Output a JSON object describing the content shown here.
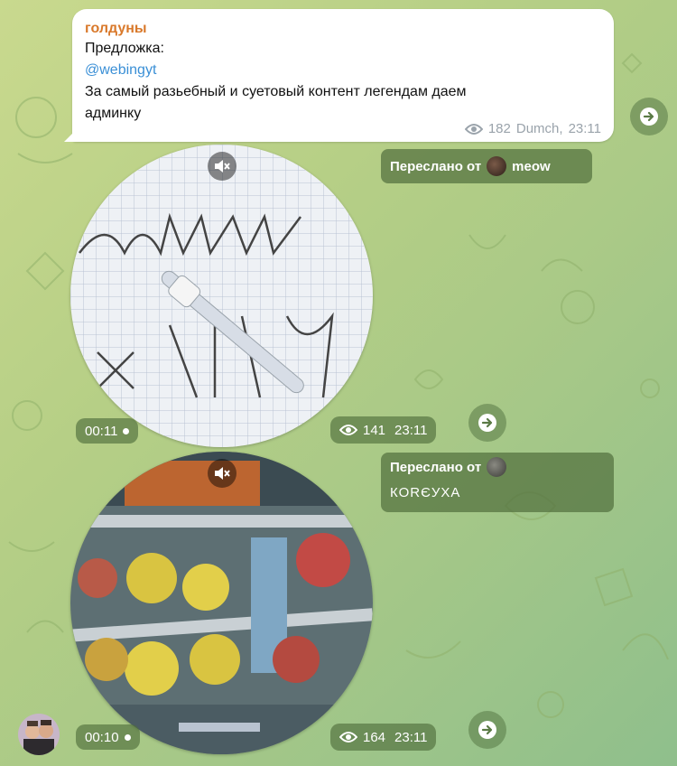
{
  "message": {
    "author": "голдуны",
    "lines": [
      "Предложка:",
      "@webingyt",
      "За самый разьебный и суетовый контент легендам даем",
      "админку"
    ],
    "views": "182",
    "signature": "Dumch,",
    "time": "23:11"
  },
  "video1": {
    "duration": "00:11",
    "views": "141",
    "time": "23:11",
    "forward_label": "Переслано от",
    "forward_name": "meow"
  },
  "video2": {
    "duration": "00:10",
    "views": "164",
    "time": "23:11",
    "forward_label": "Переслано от",
    "forward_name": "КОRЄУХА"
  },
  "icons": {
    "share": "share-arrow-icon",
    "mute": "muted-speaker-icon",
    "views": "eye-icon"
  },
  "colors": {
    "accent_author": "#d9792b",
    "link": "#3a8fd6",
    "bubble": "#ffffff"
  }
}
